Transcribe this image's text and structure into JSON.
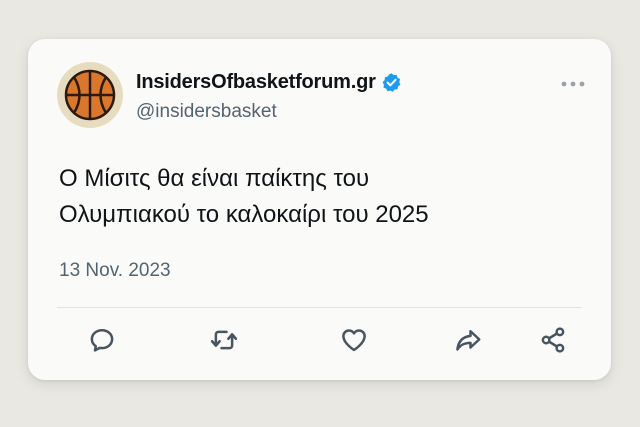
{
  "account": {
    "display_name": "InsidersOfbasketforum.gr",
    "handle": "@insidersbasket",
    "verified": true
  },
  "tweet": {
    "text_line1": "Ο Μίσιτς θα είναι παίκτης του",
    "text_line2": "Ολυμπιακού το καλοκαίρι του 2025",
    "date": "13 Nov. 2023"
  },
  "actions": [
    "reply-icon",
    "retweet-icon",
    "like-icon",
    "forward-icon",
    "share-icon"
  ],
  "colors": {
    "background": "#eae8e2",
    "card": "#fafaf8",
    "text": "#0f1419",
    "muted": "#536471",
    "verified": "#1d9bf0",
    "basketball": "#d9782d"
  }
}
